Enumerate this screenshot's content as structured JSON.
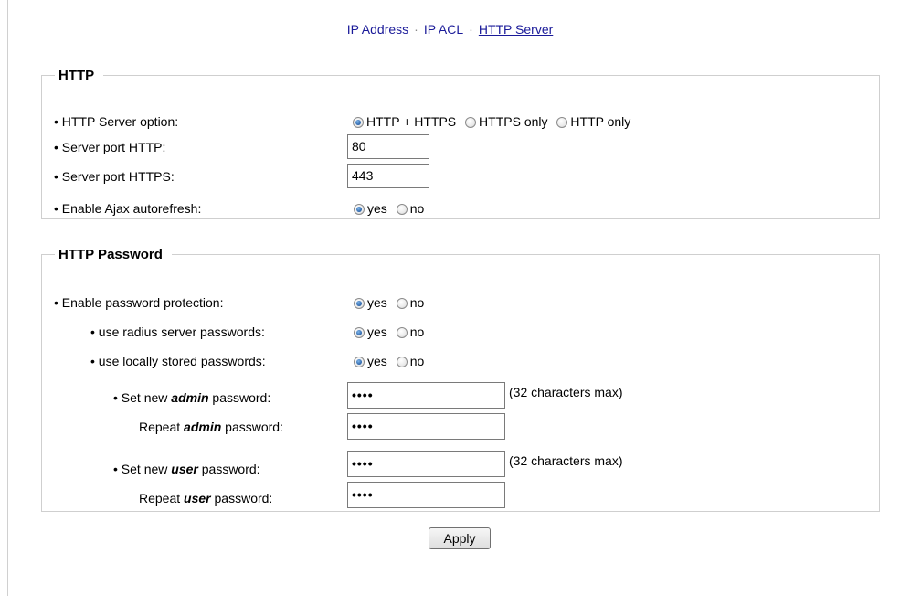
{
  "nav": {
    "items": [
      {
        "label": "IP Address",
        "active": false
      },
      {
        "label": "IP ACL",
        "active": false
      },
      {
        "label": "HTTP Server",
        "active": true
      }
    ],
    "separator": "·"
  },
  "http": {
    "legend": "HTTP",
    "server_option": {
      "label": "• HTTP Server option:",
      "options": [
        "HTTP + HTTPS",
        "HTTPS only",
        "HTTP only"
      ],
      "selected": "HTTP + HTTPS"
    },
    "port_http": {
      "label": "• Server port HTTP:",
      "value": "80"
    },
    "port_https": {
      "label": "• Server port HTTPS:",
      "value": "443"
    },
    "ajax": {
      "label": "• Enable Ajax autorefresh:",
      "options": [
        "yes",
        "no"
      ],
      "selected": "yes"
    }
  },
  "password": {
    "legend": "HTTP Password",
    "enable": {
      "label": "• Enable password protection:",
      "options": [
        "yes",
        "no"
      ],
      "selected": "yes"
    },
    "radius": {
      "label": "• use radius server passwords:",
      "options": [
        "yes",
        "no"
      ],
      "selected": "yes"
    },
    "local": {
      "label": "• use locally stored passwords:",
      "options": [
        "yes",
        "no"
      ],
      "selected": "yes"
    },
    "admin_new": {
      "prefix": "• Set new ",
      "role": "admin",
      "suffix": " password:",
      "value": "••••",
      "hint": "(32 characters max)"
    },
    "admin_repeat": {
      "prefix": "Repeat ",
      "role": "admin",
      "suffix": " password:",
      "value": "••••"
    },
    "user_new": {
      "prefix": "• Set new ",
      "role": "user",
      "suffix": " password:",
      "value": "••••",
      "hint": "(32 characters max)"
    },
    "user_repeat": {
      "prefix": "Repeat ",
      "role": "user",
      "suffix": " password:",
      "value": "••••"
    }
  },
  "apply_label": "Apply"
}
